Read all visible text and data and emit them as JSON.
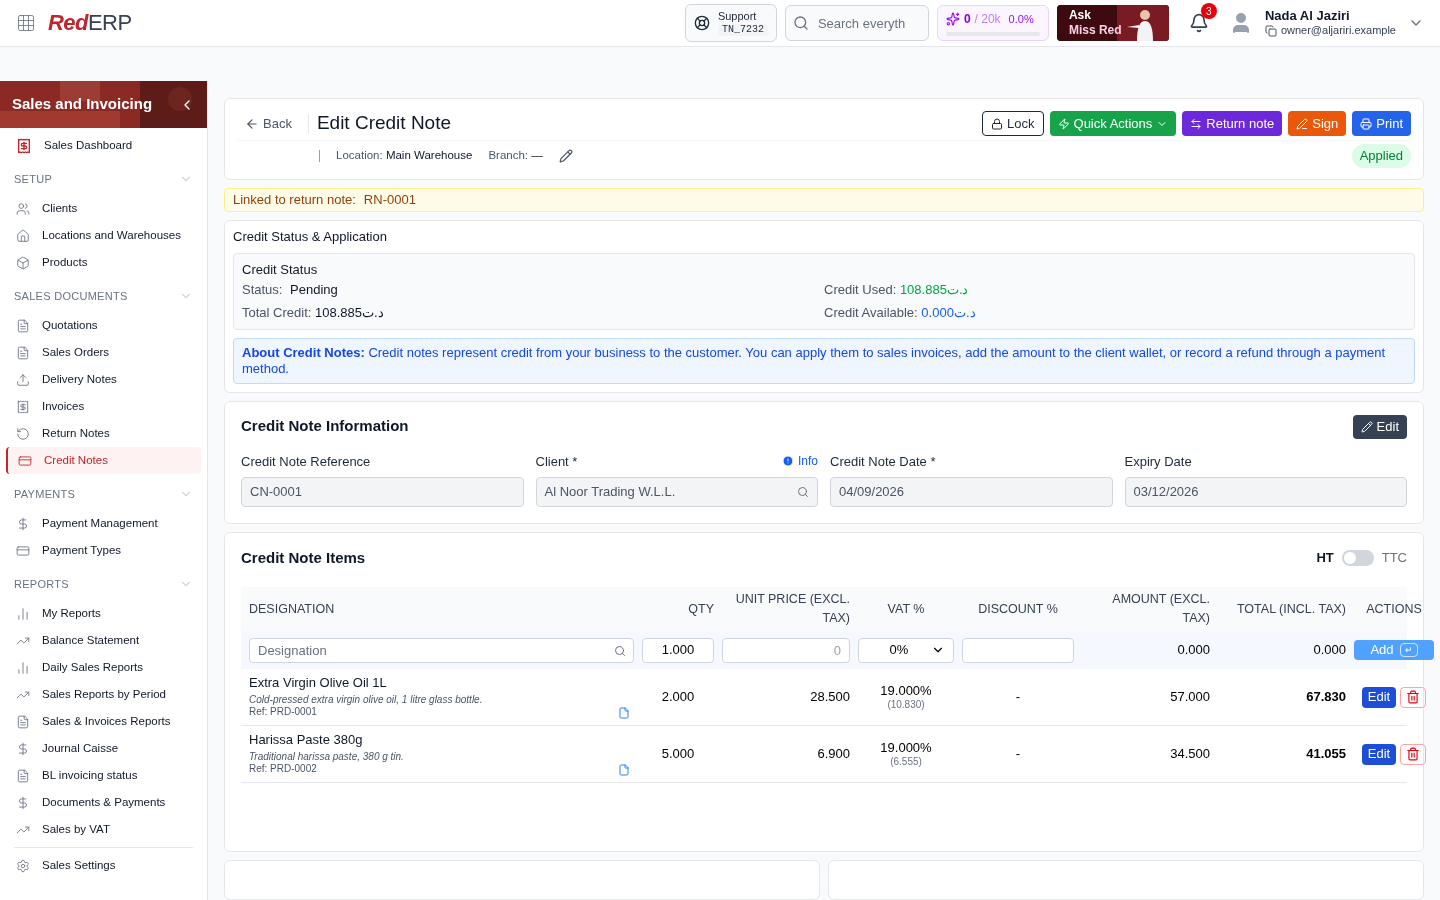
{
  "topbar": {
    "logo_a": "Red",
    "logo_b": "ERP",
    "support_label": "Support",
    "support_code": "TN_7232",
    "search_placeholder": "Search everyth",
    "credits": {
      "used": "0",
      "total": "/ 20k",
      "percent": "0.0%",
      "level": 0
    },
    "ask": [
      "Ask",
      "Miss Red"
    ],
    "notifications": "3",
    "user_name": "Nada Al Jaziri",
    "user_email": "owner@aljariri.example"
  },
  "sidebar": {
    "title": "Sales and Invoicing",
    "sections": [
      {
        "items": [
          {
            "label": "Sales Dashboard",
            "selected": false
          }
        ]
      },
      {
        "heading": "SETUP",
        "expanded": true,
        "items": [
          {
            "label": "Clients",
            "selected": false
          },
          {
            "label": "Locations and Warehouses",
            "selected": false
          },
          {
            "label": "Products",
            "selected": false
          }
        ]
      },
      {
        "heading": "SALES DOCUMENTS",
        "expanded": true,
        "items": [
          {
            "label": "Quotations",
            "selected": false
          },
          {
            "label": "Sales Orders",
            "selected": false
          },
          {
            "label": "Delivery Notes",
            "selected": false
          },
          {
            "label": "Invoices",
            "selected": false
          },
          {
            "label": "Return Notes",
            "selected": false
          },
          {
            "label": "Credit Notes",
            "selected": true
          }
        ]
      },
      {
        "heading": "PAYMENTS",
        "expanded": true,
        "items": [
          {
            "label": "Payment Management",
            "selected": false
          },
          {
            "label": "Payment Types",
            "selected": false
          }
        ]
      },
      {
        "heading": "REPORTS",
        "expanded": true,
        "items": [
          {
            "label": "My Reports",
            "selected": false
          },
          {
            "label": "Balance Statement",
            "selected": false
          },
          {
            "label": "Daily Sales Reports",
            "selected": false
          },
          {
            "label": "Sales Reports by Period",
            "selected": false
          },
          {
            "label": "Sales & Invoices Reports",
            "selected": false
          },
          {
            "label": "Journal Caisse",
            "selected": false
          },
          {
            "label": "BL invoicing status",
            "selected": false
          },
          {
            "label": "Documents & Payments",
            "selected": false
          },
          {
            "label": "Sales by VAT",
            "selected": false
          }
        ]
      },
      {
        "divider": true,
        "items": [
          {
            "label": "Sales Settings",
            "selected": false
          }
        ]
      }
    ]
  },
  "header": {
    "back": "Back",
    "title": "Edit Credit Note",
    "buttons": [
      {
        "label": "Lock",
        "kind": "outline"
      },
      {
        "label": "Quick Actions",
        "kind": "green"
      },
      {
        "label": "Return note",
        "kind": "violet"
      },
      {
        "label": "Sign",
        "kind": "orange"
      },
      {
        "label": "Print",
        "kind": "blue"
      }
    ],
    "location_label": "Location:",
    "location": "Main Warehouse",
    "branch_label": "Branch:",
    "branch": "—",
    "status": "Applied"
  },
  "linked": {
    "label": "Linked to return note:",
    "value": "RN-0001"
  },
  "credit_status": {
    "title": "Credit Status & Application",
    "box_title": "Credit Status",
    "status_label": "Status:",
    "status": "Pending",
    "total_label": "Total Credit:",
    "total": "108.885د.ت",
    "used_label": "Credit Used:",
    "used": "108.885د.ت",
    "available_label": "Credit Available:",
    "available": "0.000د.ت",
    "about_bold": "About Credit Notes:",
    "about": "Credit notes represent credit from your business to the customer. You can apply them to sales invoices, add the amount to the client wallet, or record a refund through a payment method."
  },
  "info": {
    "title": "Credit Note Information",
    "edit": "Edit",
    "fields": [
      {
        "label": "Credit Note Reference",
        "value": "CN-0001"
      },
      {
        "label": "Client *",
        "value": "Al Noor Trading W.L.L.",
        "link": "Info"
      },
      {
        "label": "Credit Note Date *",
        "value": "04/09/2026"
      },
      {
        "label": "Expiry Date",
        "value": "03/12/2026"
      }
    ]
  },
  "items": {
    "title": "Credit Note Items",
    "ht": "HT",
    "ttc": "TTC",
    "ttc_on": false,
    "columns": [
      "DESIGNATION",
      "QTY",
      "UNIT PRICE (EXCL. TAX)",
      "VAT %",
      "DISCOUNT %",
      "AMOUNT (EXCL. TAX)",
      "TOTAL (INCL. TAX)",
      "ACTIONS"
    ],
    "entry": {
      "designation_placeholder": "Designation",
      "qty": "1.000",
      "price_placeholder": "0",
      "vat": "0%",
      "amount": "0.000",
      "total": "0.000",
      "add": "Add",
      "key": "↵"
    },
    "rows": [
      {
        "name": "Extra Virgin Olive Oil 1L",
        "description": "Cold-pressed extra virgin olive oil, 1 litre glass bottle.",
        "ref": "Ref: PRD-0001",
        "qty": "2.000",
        "price": "28.500",
        "vat": "19.000%",
        "vat_amount": "(10.830)",
        "discount": "-",
        "amount": "57.000",
        "total": "67.830",
        "edit": "Edit"
      },
      {
        "name": "Harissa Paste 380g",
        "description": "Traditional harissa paste, 380 g tin.",
        "ref": "Ref: PRD-0002",
        "qty": "5.000",
        "price": "6.900",
        "vat": "19.000%",
        "vat_amount": "(6.555)",
        "discount": "-",
        "amount": "34.500",
        "total": "41.055",
        "edit": "Edit"
      }
    ]
  }
}
